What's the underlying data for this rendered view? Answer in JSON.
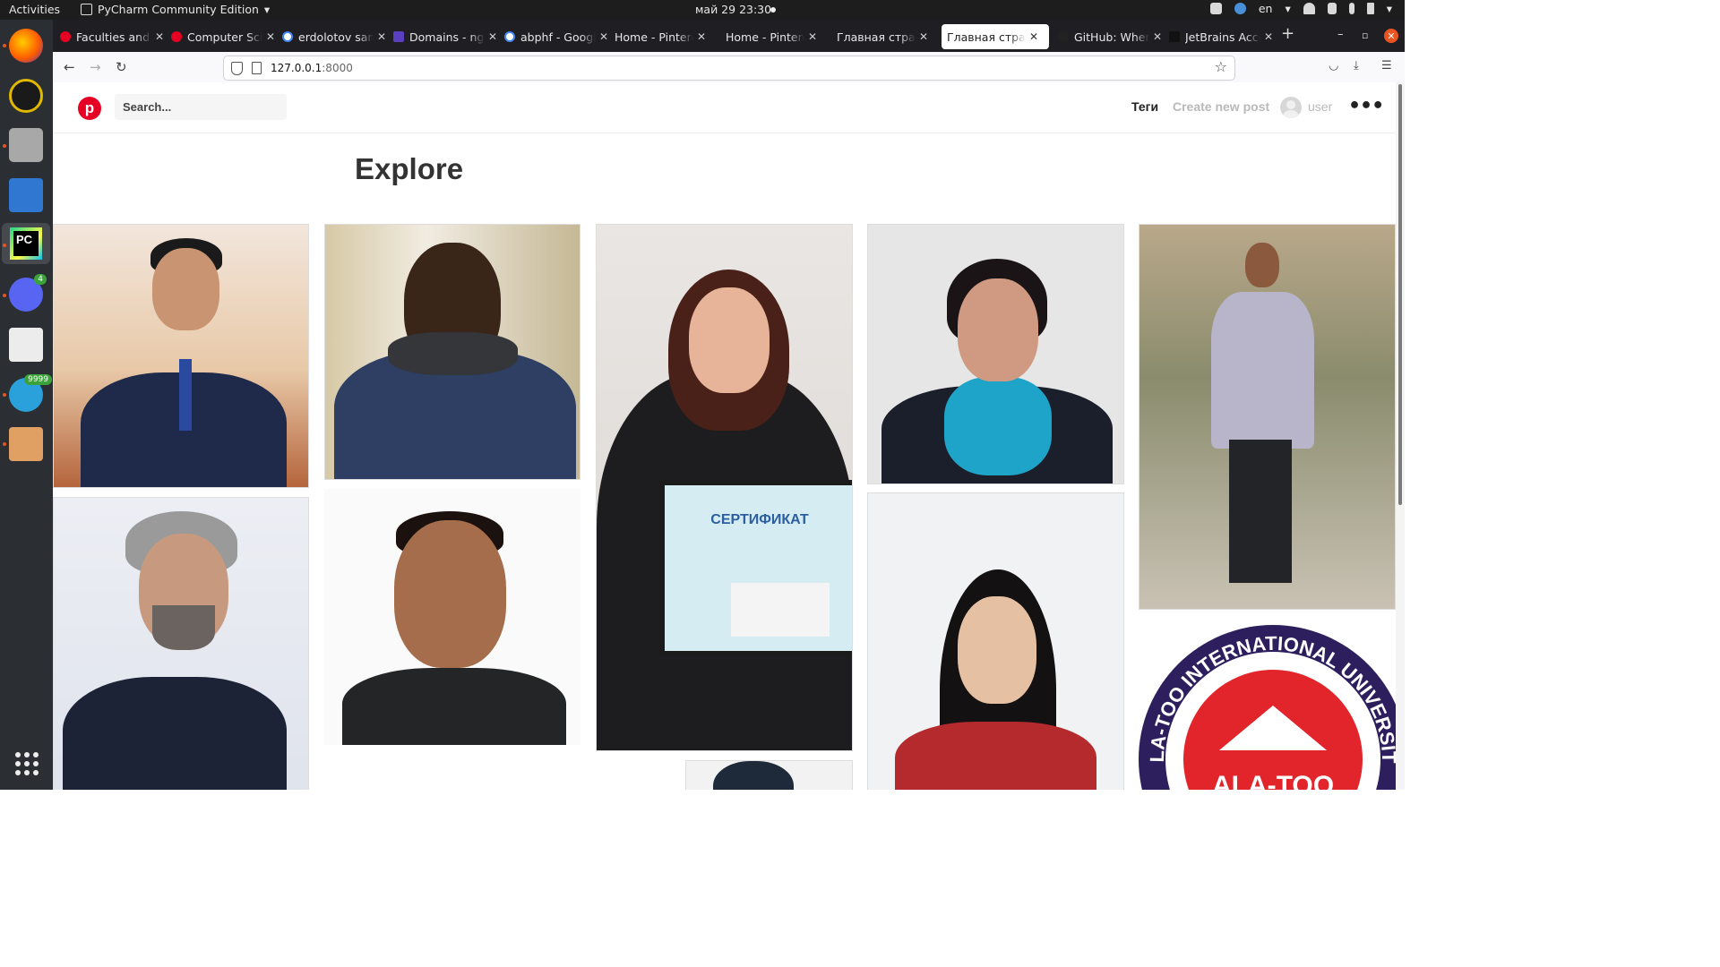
{
  "system_bar": {
    "activities": "Activities",
    "app_name": "PyCharm Community Edition",
    "app_menu_arrow": "▾",
    "clock": "май 29  23:30",
    "language": "en"
  },
  "dock": {
    "badges": {
      "discord": "4",
      "telegram": "9999"
    }
  },
  "browser": {
    "tabs": [
      {
        "title": "Faculties and c",
        "favicon_color": "#e60023"
      },
      {
        "title": "Computer Scie",
        "favicon_color": "#e60023"
      },
      {
        "title": "erdolotov san",
        "favicon_color": "#4285f4"
      },
      {
        "title": "Domains - ngr",
        "favicon_color": "#5a3fc0"
      },
      {
        "title": "abphf - Google",
        "favicon_color": "#4285f4"
      },
      {
        "title": "Home - Pinteres",
        "favicon_color": ""
      },
      {
        "title": "Home - Pinteres",
        "favicon_color": ""
      },
      {
        "title": "Главная страниц",
        "favicon_color": ""
      },
      {
        "title": "Главная страниц",
        "favicon_color": "",
        "active": true
      },
      {
        "title": "GitHub: Where",
        "favicon_color": "#222222"
      },
      {
        "title": "JetBrains Acco",
        "favicon_color": "#111111"
      }
    ],
    "new_tab": "+",
    "url_host": "127.0.0.1",
    "url_port": ":8000"
  },
  "site": {
    "logo_letter": "p",
    "search_placeholder": "Search...",
    "nav": {
      "tags": "Теги",
      "create_post": "Create new post",
      "user": "user",
      "more": "•••"
    },
    "heading": "Explore",
    "certificate_text": "СЕРТИФИКАТ",
    "seal_text": "ALA-TOO",
    "seal_ring_text": "ALA-TOO INTERNATIONAL UNIVERSITY"
  },
  "colors": {
    "brand": "#e60023",
    "topbar": "#1d1d1d",
    "dock": "#2b2f33"
  }
}
